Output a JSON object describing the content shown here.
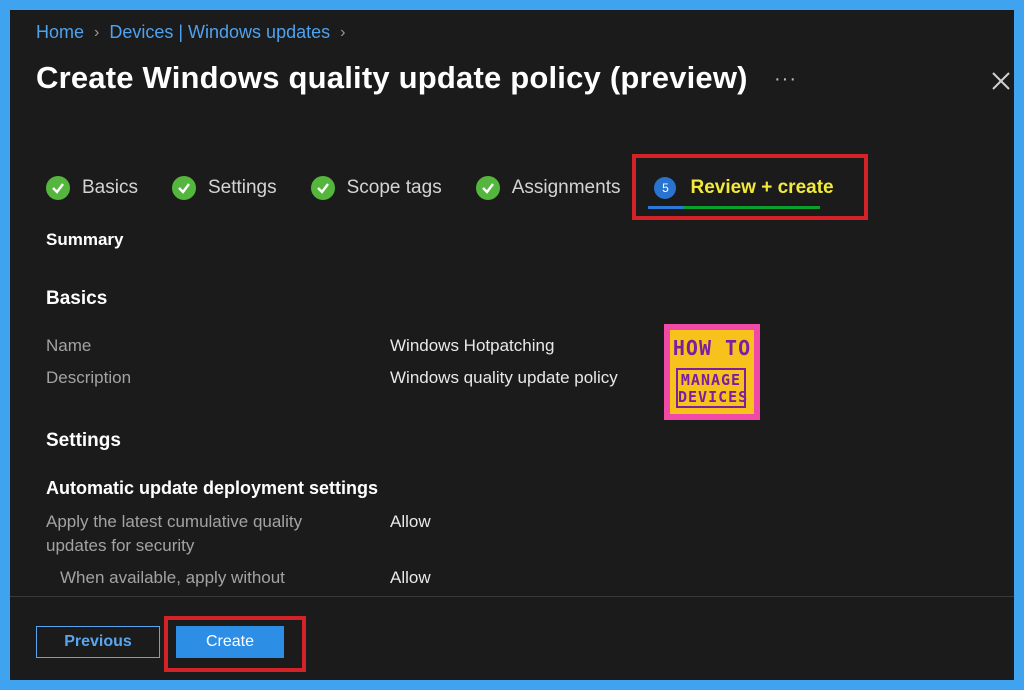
{
  "breadcrumb": {
    "items": [
      "Home",
      "Devices | Windows updates"
    ]
  },
  "page": {
    "title": "Create Windows quality update policy (preview)",
    "more": "···"
  },
  "steps": {
    "items": [
      {
        "label": "Basics",
        "state": "complete"
      },
      {
        "label": "Settings",
        "state": "complete"
      },
      {
        "label": "Scope tags",
        "state": "complete"
      },
      {
        "label": "Assignments",
        "state": "complete"
      },
      {
        "label": "Review + create",
        "state": "active",
        "number": "5"
      }
    ]
  },
  "summary": {
    "heading": "Summary",
    "basics": {
      "heading": "Basics",
      "name_label": "Name",
      "name_value": "Windows Hotpatching",
      "description_label": "Description",
      "description_value": "Windows quality update policy"
    },
    "settings": {
      "heading": "Settings",
      "subheading": "Automatic update deployment settings",
      "rows": [
        {
          "label_line1": "Apply the latest cumulative quality",
          "label_line2": "updates for security",
          "value": "Allow"
        },
        {
          "label_line1": "When available, apply without",
          "value": "Allow"
        }
      ]
    }
  },
  "logo": {
    "line1": "HOW TO",
    "line2": "MANAGE",
    "line3": "DEVICES"
  },
  "footer": {
    "previous_label": "Previous",
    "create_label": "Create"
  },
  "colors": {
    "accent": "#2d8ee6",
    "link": "#4ea2f0",
    "check": "#54b63c",
    "highlight_text": "#f2ea3a",
    "annotation_box": "#d42229"
  }
}
